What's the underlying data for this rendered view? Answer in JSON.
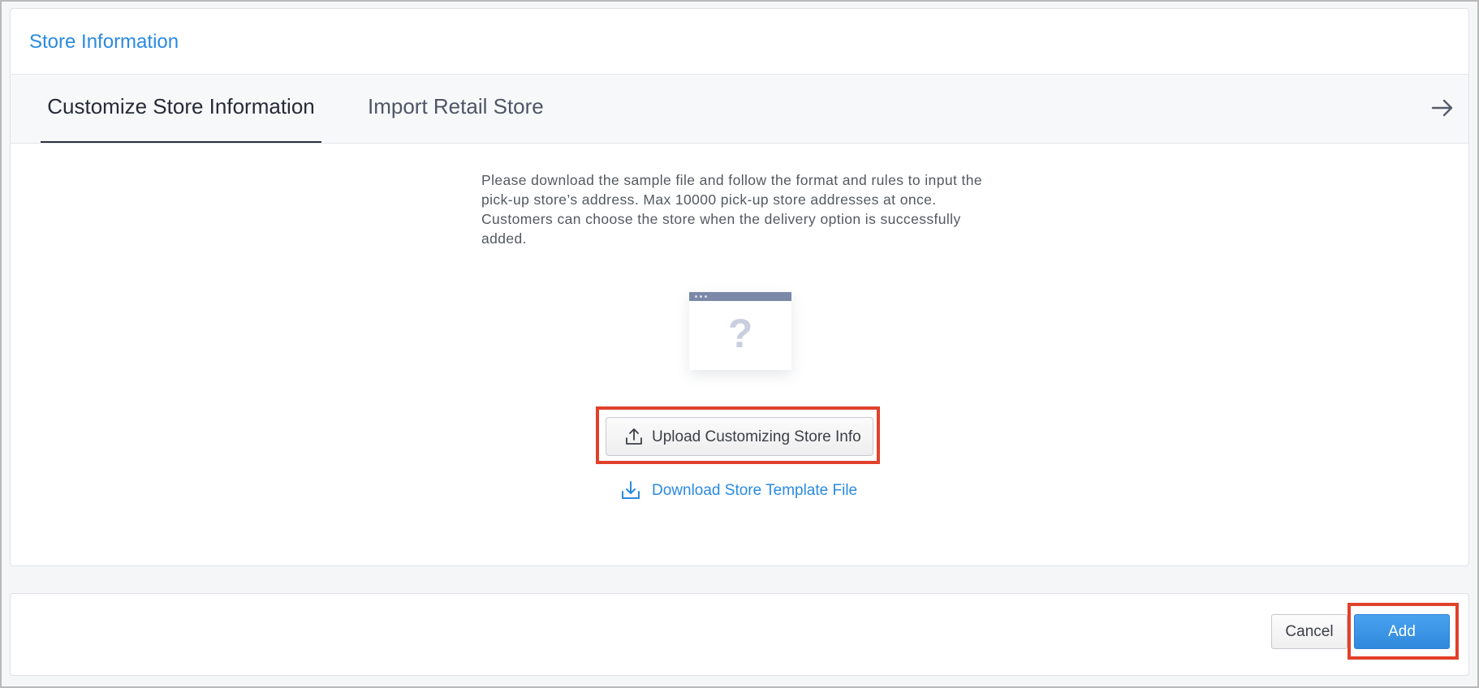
{
  "header": {
    "title": "Store Information"
  },
  "tabs": [
    {
      "label": "Customize Store Information",
      "active": true
    },
    {
      "label": "Import Retail Store",
      "active": false
    }
  ],
  "tabs_nav_icon": "arrow-right-icon",
  "main": {
    "description": "Please download the sample file and follow the format and rules to input the pick-up store’s address. Max 10000 pick-up store addresses at once. Customers can choose the store when the delivery option is successfully added.",
    "placeholder_icon": "empty-window-question-icon",
    "upload_button": {
      "label": "Upload Customizing Store Info",
      "icon": "upload-icon"
    },
    "download_link": {
      "label": "Download Store Template File",
      "icon": "download-icon"
    }
  },
  "footer": {
    "cancel_label": "Cancel",
    "add_label": "Add"
  },
  "colors": {
    "accent": "#2a8ae0",
    "primary_button": "#3a93e4",
    "highlight": "#e0412b"
  }
}
